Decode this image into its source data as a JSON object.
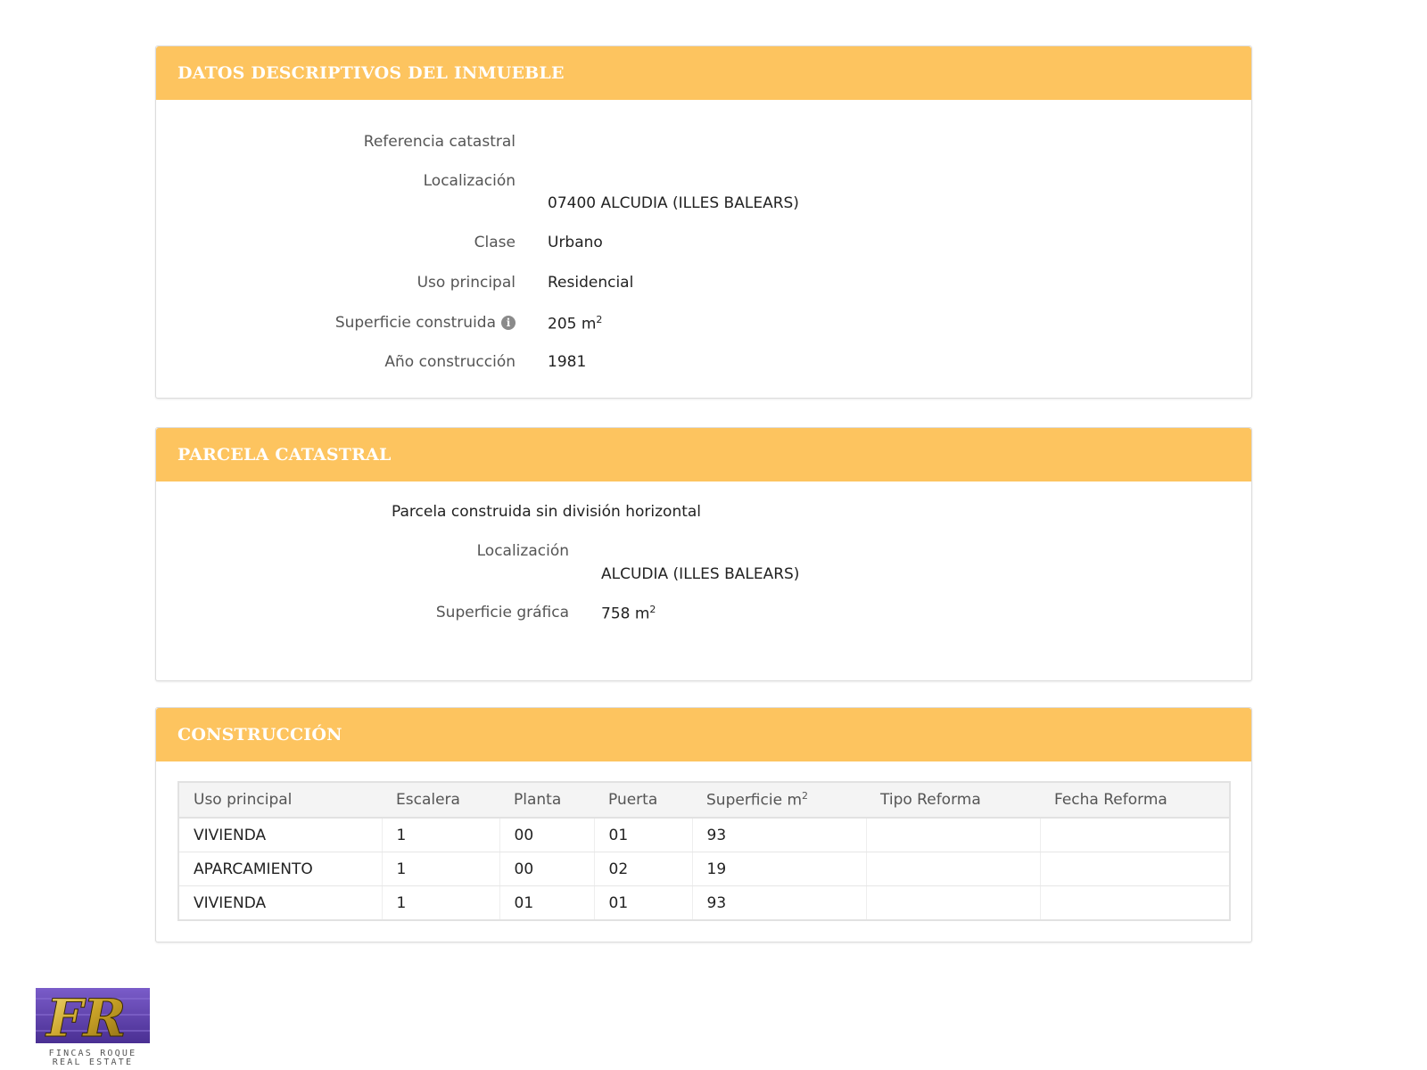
{
  "panel1": {
    "title": "DATOS DESCRIPTIVOS DEL INMUEBLE",
    "ref_label": "Referencia catastral",
    "loc_label": "Localización",
    "loc_value": "07400 ALCUDIA (ILLES BALEARS)",
    "clase_label": "Clase",
    "clase_value": "Urbano",
    "uso_label": "Uso principal",
    "uso_value": "Residencial",
    "sup_label": "Superficie construida",
    "sup_value": "205 m",
    "sup_exp": "2",
    "anio_label": "Año construcción",
    "anio_value": "1981"
  },
  "panel2": {
    "title": "PARCELA CATASTRAL",
    "subtitle": "Parcela construida sin división horizontal",
    "loc_label": "Localización",
    "loc_value": "ALCUDIA (ILLES BALEARS)",
    "sup_label": "Superficie gráfica",
    "sup_value": "758 m",
    "sup_exp": "2"
  },
  "panel3": {
    "title": "CONSTRUCCIÓN",
    "headers": [
      "Uso principal",
      "Escalera",
      "Planta",
      "Puerta",
      "Superficie m",
      "Tipo Reforma",
      "Fecha Reforma"
    ],
    "sup_header_exp": "2",
    "rows": [
      [
        "VIVIENDA",
        "1",
        "00",
        "01",
        "93",
        "",
        ""
      ],
      [
        "APARCAMIENTO",
        "1",
        "00",
        "02",
        "19",
        "",
        ""
      ],
      [
        "VIVIENDA",
        "1",
        "01",
        "01",
        "93",
        "",
        ""
      ]
    ]
  },
  "logo": {
    "initials": "FR",
    "line1": "FINCAS ROQUE",
    "line2": "REAL ESTATE"
  },
  "colors": {
    "header_bg": "#fdc45f",
    "logo_bg": "#5b3fa8",
    "logo_gold": "#c9a227"
  }
}
